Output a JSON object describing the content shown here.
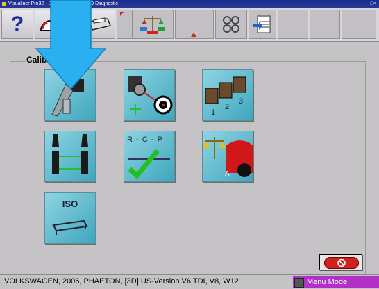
{
  "window": {
    "title": "Visualiner Pro32 - D... ...ne Mode - V3D Diagnostic",
    "controls": "_□×"
  },
  "toolbar": {
    "help_label": "?"
  },
  "calibration": {
    "group_label": "Calib",
    "buttons": [
      {
        "name": "camera-calibration-button",
        "icon": "camera-fixture-icon"
      },
      {
        "name": "target-calibration-button",
        "icon": "camera-target-icon"
      },
      {
        "name": "multi-camera-calibration-button",
        "icon": "multi-camera-icon"
      },
      {
        "name": "wheel-sensor-calibration-button",
        "icon": "wheel-sensors-icon"
      },
      {
        "name": "rcp-check-button",
        "icon": "rcp-check-icon",
        "label": "R - C - P"
      },
      {
        "name": "level-calibration-button",
        "icon": "scale-car-icon"
      },
      {
        "name": "iso-calibration-button",
        "icon": "iso-bar-icon",
        "label": "ISO"
      }
    ]
  },
  "status": {
    "vehicle": "VOLKSWAGEN, 2006, PHAETON, [3D] US-Version V6 TDI, V8, W12",
    "mode": "Menu Mode"
  },
  "colors": {
    "titlebar": "#1a2c8c",
    "tile": "#4fb0c6",
    "mode": "#b030c8",
    "arrow": "#2ab0f0",
    "exit": "#d02020"
  }
}
